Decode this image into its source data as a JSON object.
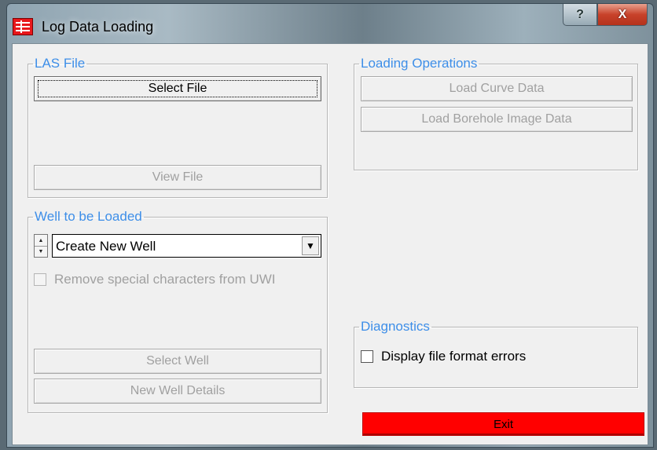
{
  "window": {
    "title": "Log Data Loading",
    "help_glyph": "?",
    "close_glyph": "X"
  },
  "las_file": {
    "legend": "LAS File",
    "select_file": "Select File",
    "view_file": "View File"
  },
  "well": {
    "legend": "Well to be Loaded",
    "combo_value": "Create New Well",
    "remove_special_label": "Remove special characters from UWI",
    "remove_special_checked": false,
    "select_well": "Select Well",
    "new_well_details": "New Well Details"
  },
  "loading_ops": {
    "legend": "Loading Operations",
    "load_curve": "Load Curve Data",
    "load_borehole": "Load Borehole Image Data"
  },
  "diagnostics": {
    "legend": "Diagnostics",
    "display_errors_label": "Display file format errors",
    "display_errors_checked": false
  },
  "exit": {
    "label": "Exit",
    "color": "#ff0000"
  },
  "colors": {
    "legend_text": "#3d8ee8",
    "disabled_text": "#a0a0a0",
    "dialog_bg": "#f0f0f0"
  }
}
